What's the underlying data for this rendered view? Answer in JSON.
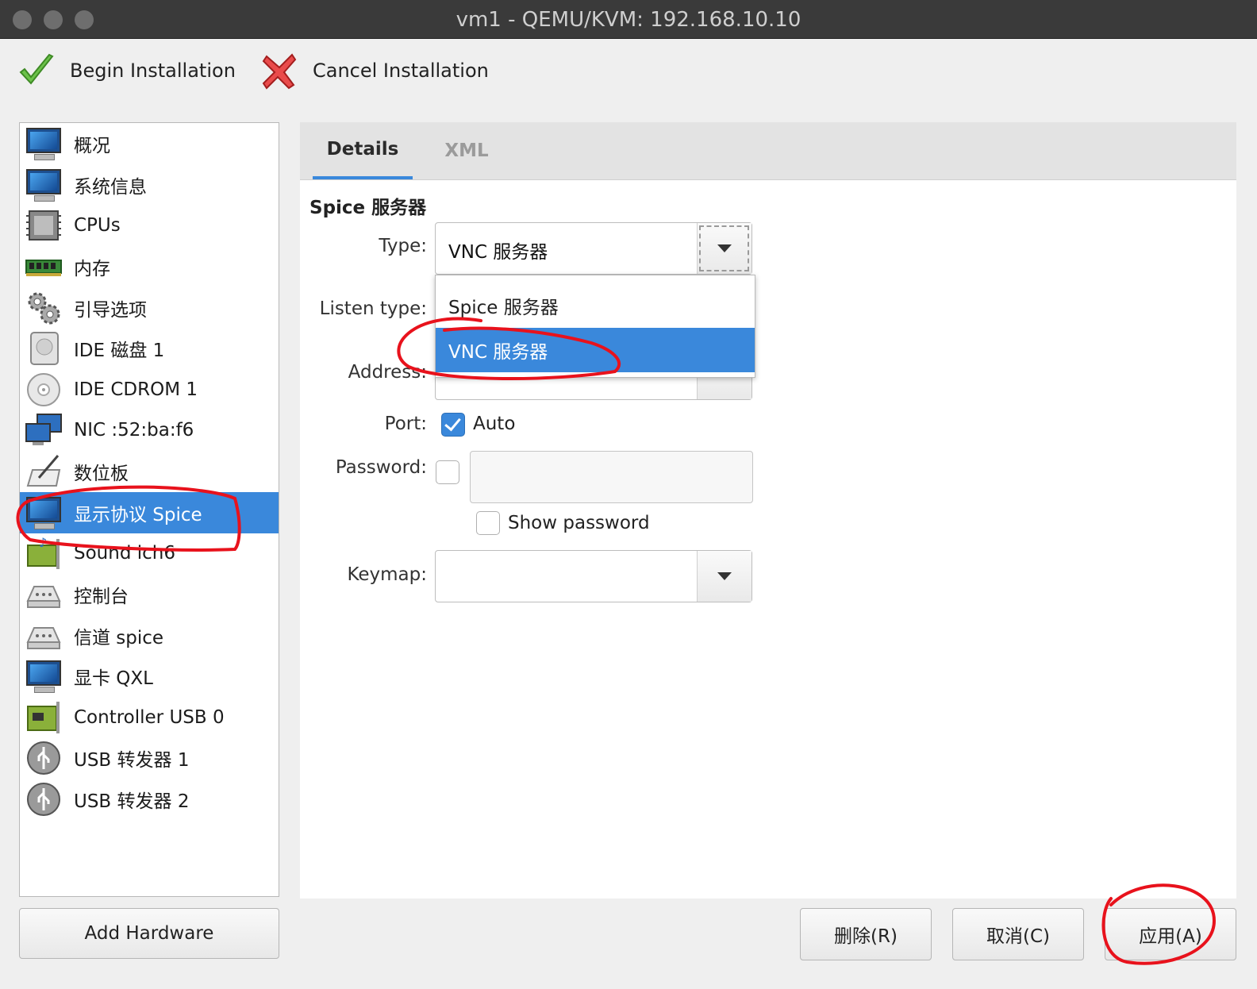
{
  "window": {
    "title": "vm1 - QEMU/KVM: 192.168.10.10"
  },
  "toolbar": {
    "begin_label": "Begin Installation",
    "cancel_label": "Cancel Installation"
  },
  "sidebar": {
    "items": [
      {
        "label": "概况",
        "icon": "monitor-icon"
      },
      {
        "label": "系统信息",
        "icon": "monitor-icon"
      },
      {
        "label": "CPUs",
        "icon": "cpu-icon"
      },
      {
        "label": "内存",
        "icon": "memory-icon"
      },
      {
        "label": "引导选项",
        "icon": "gears-icon"
      },
      {
        "label": "IDE 磁盘 1",
        "icon": "disk-icon"
      },
      {
        "label": "IDE CDROM 1",
        "icon": "cdrom-icon"
      },
      {
        "label": "NIC :52:ba:f6",
        "icon": "network-icon"
      },
      {
        "label": "数位板",
        "icon": "tablet-icon"
      },
      {
        "label": "显示协议 Spice",
        "icon": "monitor-icon",
        "selected": true
      },
      {
        "label": "Sound ich6",
        "icon": "sound-card-icon"
      },
      {
        "label": "控制台",
        "icon": "serial-icon"
      },
      {
        "label": "信道 spice",
        "icon": "serial-icon"
      },
      {
        "label": "显卡 QXL",
        "icon": "monitor-icon"
      },
      {
        "label": "Controller USB 0",
        "icon": "controller-card-icon"
      },
      {
        "label": "USB 转发器 1",
        "icon": "usb-icon"
      },
      {
        "label": "USB 转发器 2",
        "icon": "usb-icon"
      }
    ],
    "add_hardware_label": "Add Hardware"
  },
  "tabs": {
    "details": "Details",
    "xml": "XML"
  },
  "form": {
    "section_title": "Spice 服务器",
    "type_label": "Type:",
    "type_value": "VNC 服务器",
    "listen_type_label": "Listen type:",
    "address_label": "Address:",
    "port_label": "Port:",
    "port_auto_label": "Auto",
    "port_auto_checked": true,
    "password_label": "Password:",
    "password_checked": false,
    "password_value": "",
    "show_password_label": "Show password",
    "keymap_label": "Keymap:",
    "keymap_value": ""
  },
  "dropdown": {
    "options": [
      "Spice 服务器",
      "VNC 服务器"
    ],
    "selected_index": 1
  },
  "buttons": {
    "delete_label": "删除(R)",
    "cancel_label": "取消(C)",
    "apply_label": "应用(A)"
  },
  "colors": {
    "accent": "#3a88db",
    "annotation": "#e8121c"
  }
}
